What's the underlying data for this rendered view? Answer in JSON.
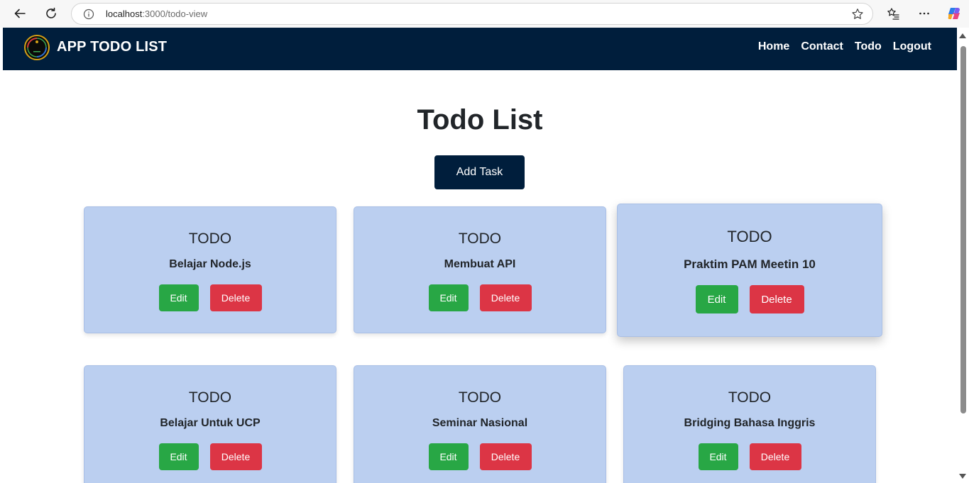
{
  "browser": {
    "url_host": "localhost",
    "url_path": ":3000/todo-view"
  },
  "navbar": {
    "brand": "APP TODO LIST",
    "links": [
      "Home",
      "Contact",
      "Todo",
      "Logout"
    ]
  },
  "main": {
    "title": "Todo List",
    "add_button": "Add Task",
    "edit_label": "Edit",
    "delete_label": "Delete",
    "tasks": [
      {
        "status": "TODO",
        "title": "Belajar Node.js"
      },
      {
        "status": "TODO",
        "title": "Membuat API"
      },
      {
        "status": "TODO",
        "title": "Praktim PAM Meetin 10"
      },
      {
        "status": "TODO",
        "title": "Belajar Untuk UCP"
      },
      {
        "status": "TODO",
        "title": "Seminar Nasional"
      },
      {
        "status": "TODO",
        "title": "Bridging Bahasa Inggris"
      }
    ]
  },
  "colors": {
    "navbar_bg": "#001e3c",
    "card_bg": "#bbcff0",
    "edit_button": "#28a745",
    "delete_button": "#dc3545"
  }
}
